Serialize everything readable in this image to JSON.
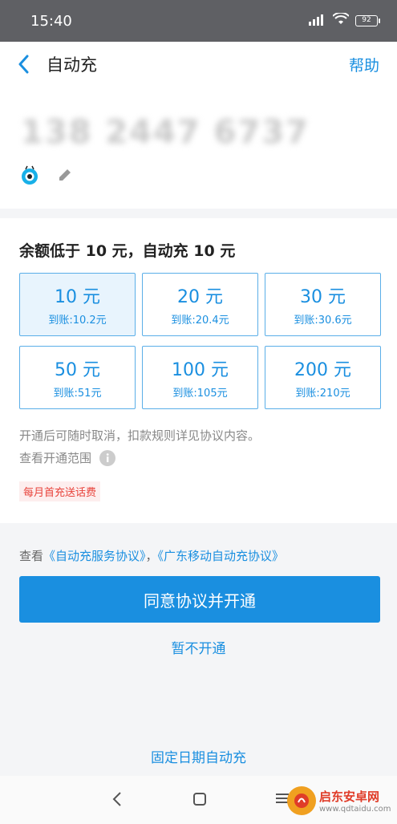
{
  "status_bar": {
    "time": "15:40",
    "network": "4G",
    "battery": "92"
  },
  "nav": {
    "title": "自动充",
    "help": "帮助"
  },
  "account": {
    "phone_masked": "138 2447 6737"
  },
  "auto_recharge": {
    "title": "余额低于 10 元，自动充 10 元",
    "options": [
      {
        "amount": "10 元",
        "credited": "到账:10.2元",
        "selected": true
      },
      {
        "amount": "20 元",
        "credited": "到账:20.4元",
        "selected": false
      },
      {
        "amount": "30 元",
        "credited": "到账:30.6元",
        "selected": false
      },
      {
        "amount": "50 元",
        "credited": "到账:51元",
        "selected": false
      },
      {
        "amount": "100 元",
        "credited": "到账:105元",
        "selected": false
      },
      {
        "amount": "200 元",
        "credited": "到账:210元",
        "selected": false
      }
    ],
    "note": "开通后可随时取消，扣款规则详见协议内容。",
    "scope_link": "查看开通范围",
    "promo_badge": "每月首充送话费"
  },
  "agreement": {
    "prefix": "查看",
    "service_agreement": "《自动充服务协议》",
    "separator": "，",
    "provider_agreement": "《广东移动自动充协议》",
    "agree_button": "同意协议并开通",
    "decline": "暂不开通",
    "fixed_date": "固定日期自动充"
  },
  "watermark": {
    "title": "启东安卓网",
    "url": "www.qdtaidu.com"
  },
  "colors": {
    "accent": "#1a8fe0",
    "promo": "#e8423a",
    "status_bar": "#5f6064"
  }
}
